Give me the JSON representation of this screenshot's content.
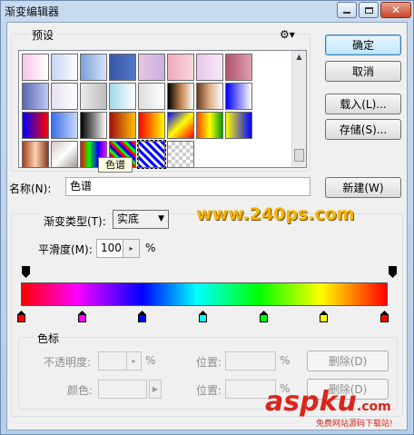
{
  "window": {
    "title": "渐变编辑器"
  },
  "presets": {
    "label": "预设",
    "tooltip": "色谱"
  },
  "buttons": {
    "ok": "确定",
    "cancel": "取消",
    "load": "载入(L)...",
    "save": "存储(S)...",
    "new": "新建(W)"
  },
  "name_field": {
    "label": "名称(N):",
    "value": "色谱"
  },
  "gradient_type": {
    "label": "渐变类型(T):",
    "value": "实底"
  },
  "smoothness": {
    "label": "平滑度(M):",
    "value": "100",
    "unit": "%"
  },
  "stops_group": {
    "label": "色标",
    "opacity_label": "不透明度:",
    "opacity_unit": "%",
    "location_label_1": "位置:",
    "location_unit_1": "%",
    "delete_1": "删除(D)",
    "color_label": "颜色:",
    "location_label_2": "位置:",
    "location_unit_2": "%",
    "delete_2": "删除(D)"
  },
  "color_stops": [
    "#ff0000",
    "#ff00ff",
    "#0000ff",
    "#00ffff",
    "#00ff00",
    "#ffff00",
    "#ff0000"
  ],
  "watermarks": {
    "site1": "www.240ps.com",
    "site2_a": "asp",
    "site2_b": "ku",
    "site2_c": ".com",
    "site2_sub": "免费网站源码下载站!"
  }
}
